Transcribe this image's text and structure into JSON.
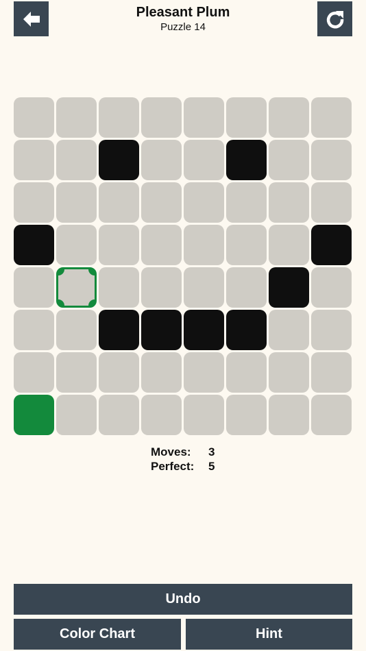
{
  "header": {
    "title": "Pleasant Plum",
    "subtitle": "Puzzle 14",
    "back_icon": "arrow-left-icon",
    "restart_icon": "restart-icon"
  },
  "board": {
    "rows": 8,
    "cols": 8,
    "cells": [
      [
        "empty",
        "empty",
        "empty",
        "empty",
        "empty",
        "empty",
        "empty",
        "empty"
      ],
      [
        "empty",
        "empty",
        "wall",
        "empty",
        "empty",
        "wall",
        "empty",
        "empty"
      ],
      [
        "empty",
        "empty",
        "empty",
        "empty",
        "empty",
        "empty",
        "empty",
        "empty"
      ],
      [
        "wall",
        "empty",
        "empty",
        "empty",
        "empty",
        "empty",
        "empty",
        "wall"
      ],
      [
        "empty",
        "target",
        "empty",
        "empty",
        "empty",
        "empty",
        "wall",
        "empty"
      ],
      [
        "empty",
        "empty",
        "wall",
        "wall",
        "wall",
        "wall",
        "empty",
        "empty"
      ],
      [
        "empty",
        "empty",
        "empty",
        "empty",
        "empty",
        "empty",
        "empty",
        "empty"
      ],
      [
        "player",
        "empty",
        "empty",
        "empty",
        "empty",
        "empty",
        "empty",
        "empty"
      ]
    ],
    "colors": {
      "empty": "#cfccc5",
      "wall": "#0f0f0f",
      "player": "#138a3c",
      "target_outline": "#138a3c"
    }
  },
  "stats": {
    "moves_label": "Moves:",
    "moves_value": "3",
    "perfect_label": "Perfect:",
    "perfect_value": "5"
  },
  "buttons": {
    "undo": "Undo",
    "color_chart": "Color Chart",
    "hint": "Hint"
  },
  "theme": {
    "background": "#fdf9f1",
    "button": "#394652"
  }
}
